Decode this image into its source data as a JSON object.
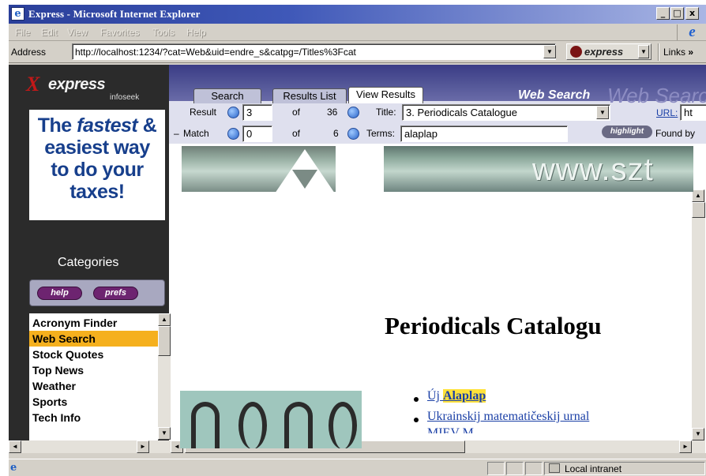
{
  "window": {
    "title": "Express - Microsoft Internet Explorer",
    "minimize": "_",
    "restore": "□",
    "close": "x"
  },
  "menu": [
    "File",
    "Edit",
    "View",
    "Favorites",
    "Tools",
    "Help"
  ],
  "address": {
    "label": "Address",
    "url": "http://localhost:1234/?cat=Web&uid=endre_s&catpg=/Titles%3Fcat",
    "dropdown": "▼"
  },
  "toolbar": {
    "express_label": "express",
    "links_label": "Links",
    "links_chevron": "»"
  },
  "sidebar": {
    "brand_name": "express",
    "brand_sub": "infoseek",
    "ad_lines": [
      "The fastest &",
      "easiest way",
      "to do your",
      "taxes!"
    ],
    "categories_title": "Categories",
    "help_btn": "help",
    "prefs_btn": "prefs",
    "items": [
      {
        "label": "Acronym Finder"
      },
      {
        "label": "Web Search"
      },
      {
        "label": "Stock Quotes"
      },
      {
        "label": "Top News"
      },
      {
        "label": "Weather"
      },
      {
        "label": "Sports"
      },
      {
        "label": "Tech Info"
      }
    ],
    "selected_index": 1
  },
  "search": {
    "tabs": [
      "Search",
      "Results List",
      "View Results"
    ],
    "active_tab": "View Results",
    "brand_title": "Web Search",
    "brand_ghost": "Web Search",
    "result_label": "Result",
    "result_value": "3",
    "of_label": "of",
    "result_total": "36",
    "title_label": "Title:",
    "title_value": "3. Periodicals Catalogue",
    "url_label": "URL:",
    "url_value": "ht",
    "match_prefix": "–",
    "match_label": "Match",
    "match_value": "0",
    "match_total": "6",
    "terms_label": "Terms:",
    "terms_value": "alaplap",
    "highlight_btn": "highlight",
    "found_by": "Found by"
  },
  "page": {
    "banner_text": "www.szt",
    "heading": "Periodicals Catalogu",
    "links": [
      {
        "prefix": "Új",
        "highlight": "Alaplap"
      },
      {
        "text": "Ukrainskij matematičeskij urnal"
      }
    ],
    "partial_line": "MIEV M"
  },
  "status": {
    "zone": "Local intranet"
  },
  "colors": {
    "accent_selection": "#f5b01e",
    "titlebar": "#2a3f9a",
    "link": "#1a3fa6",
    "highlight": "#ffe23a"
  }
}
